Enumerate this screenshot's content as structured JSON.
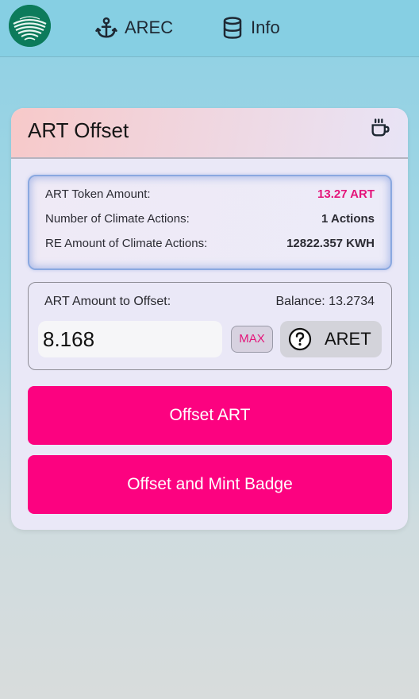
{
  "header": {
    "logo_icon": "arec-logo-icon",
    "nav": [
      {
        "label": "AREC",
        "icon": "anchor-icon"
      },
      {
        "label": "Info",
        "icon": "database-icon"
      }
    ]
  },
  "card": {
    "title": "ART Offset",
    "title_icon": "coffee-cup-icon",
    "info": {
      "token_amount_label": "ART Token Amount:",
      "token_amount_value": "13.27 ART",
      "actions_label": "Number of Climate Actions:",
      "actions_value": "1 Actions",
      "re_amount_label": "RE Amount of Climate Actions:",
      "re_amount_value": "12822.357 KWH"
    },
    "offset": {
      "label": "ART Amount to Offset:",
      "balance": "Balance: 13.2734",
      "amount_value": "8.168",
      "max_label": "MAX",
      "token_label": "ARET",
      "token_icon": "question-circle-icon"
    },
    "buttons": {
      "offset": "Offset ART",
      "offset_mint": "Offset and Mint Badge"
    }
  },
  "colors": {
    "accent": "#fc0280",
    "highlight_text": "#e4157a",
    "header_bg": "#86cfe3"
  }
}
